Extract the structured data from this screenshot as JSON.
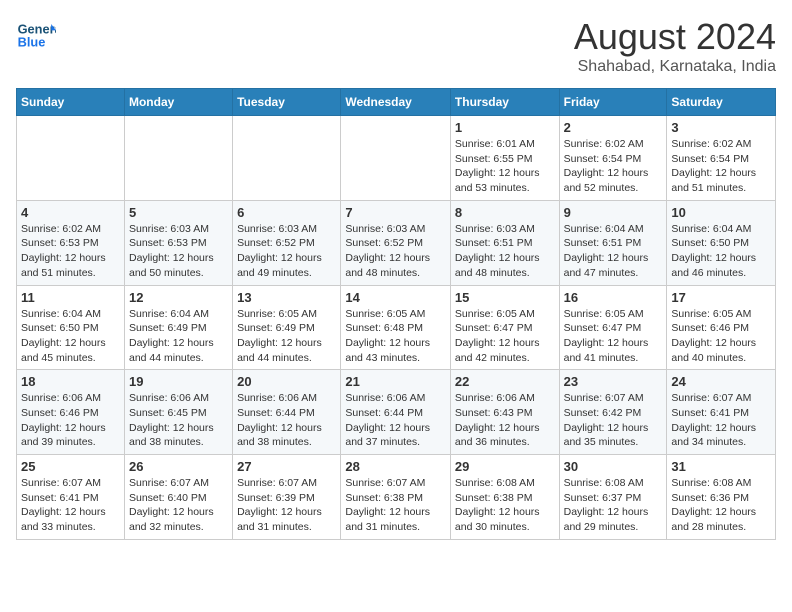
{
  "header": {
    "logo_line1": "General",
    "logo_line2": "Blue",
    "month": "August 2024",
    "location": "Shahabad, Karnataka, India"
  },
  "weekdays": [
    "Sunday",
    "Monday",
    "Tuesday",
    "Wednesday",
    "Thursday",
    "Friday",
    "Saturday"
  ],
  "weeks": [
    [
      {
        "day": "",
        "info": ""
      },
      {
        "day": "",
        "info": ""
      },
      {
        "day": "",
        "info": ""
      },
      {
        "day": "",
        "info": ""
      },
      {
        "day": "1",
        "info": "Sunrise: 6:01 AM\nSunset: 6:55 PM\nDaylight: 12 hours\nand 53 minutes."
      },
      {
        "day": "2",
        "info": "Sunrise: 6:02 AM\nSunset: 6:54 PM\nDaylight: 12 hours\nand 52 minutes."
      },
      {
        "day": "3",
        "info": "Sunrise: 6:02 AM\nSunset: 6:54 PM\nDaylight: 12 hours\nand 51 minutes."
      }
    ],
    [
      {
        "day": "4",
        "info": "Sunrise: 6:02 AM\nSunset: 6:53 PM\nDaylight: 12 hours\nand 51 minutes."
      },
      {
        "day": "5",
        "info": "Sunrise: 6:03 AM\nSunset: 6:53 PM\nDaylight: 12 hours\nand 50 minutes."
      },
      {
        "day": "6",
        "info": "Sunrise: 6:03 AM\nSunset: 6:52 PM\nDaylight: 12 hours\nand 49 minutes."
      },
      {
        "day": "7",
        "info": "Sunrise: 6:03 AM\nSunset: 6:52 PM\nDaylight: 12 hours\nand 48 minutes."
      },
      {
        "day": "8",
        "info": "Sunrise: 6:03 AM\nSunset: 6:51 PM\nDaylight: 12 hours\nand 48 minutes."
      },
      {
        "day": "9",
        "info": "Sunrise: 6:04 AM\nSunset: 6:51 PM\nDaylight: 12 hours\nand 47 minutes."
      },
      {
        "day": "10",
        "info": "Sunrise: 6:04 AM\nSunset: 6:50 PM\nDaylight: 12 hours\nand 46 minutes."
      }
    ],
    [
      {
        "day": "11",
        "info": "Sunrise: 6:04 AM\nSunset: 6:50 PM\nDaylight: 12 hours\nand 45 minutes."
      },
      {
        "day": "12",
        "info": "Sunrise: 6:04 AM\nSunset: 6:49 PM\nDaylight: 12 hours\nand 44 minutes."
      },
      {
        "day": "13",
        "info": "Sunrise: 6:05 AM\nSunset: 6:49 PM\nDaylight: 12 hours\nand 44 minutes."
      },
      {
        "day": "14",
        "info": "Sunrise: 6:05 AM\nSunset: 6:48 PM\nDaylight: 12 hours\nand 43 minutes."
      },
      {
        "day": "15",
        "info": "Sunrise: 6:05 AM\nSunset: 6:47 PM\nDaylight: 12 hours\nand 42 minutes."
      },
      {
        "day": "16",
        "info": "Sunrise: 6:05 AM\nSunset: 6:47 PM\nDaylight: 12 hours\nand 41 minutes."
      },
      {
        "day": "17",
        "info": "Sunrise: 6:05 AM\nSunset: 6:46 PM\nDaylight: 12 hours\nand 40 minutes."
      }
    ],
    [
      {
        "day": "18",
        "info": "Sunrise: 6:06 AM\nSunset: 6:46 PM\nDaylight: 12 hours\nand 39 minutes."
      },
      {
        "day": "19",
        "info": "Sunrise: 6:06 AM\nSunset: 6:45 PM\nDaylight: 12 hours\nand 38 minutes."
      },
      {
        "day": "20",
        "info": "Sunrise: 6:06 AM\nSunset: 6:44 PM\nDaylight: 12 hours\nand 38 minutes."
      },
      {
        "day": "21",
        "info": "Sunrise: 6:06 AM\nSunset: 6:44 PM\nDaylight: 12 hours\nand 37 minutes."
      },
      {
        "day": "22",
        "info": "Sunrise: 6:06 AM\nSunset: 6:43 PM\nDaylight: 12 hours\nand 36 minutes."
      },
      {
        "day": "23",
        "info": "Sunrise: 6:07 AM\nSunset: 6:42 PM\nDaylight: 12 hours\nand 35 minutes."
      },
      {
        "day": "24",
        "info": "Sunrise: 6:07 AM\nSunset: 6:41 PM\nDaylight: 12 hours\nand 34 minutes."
      }
    ],
    [
      {
        "day": "25",
        "info": "Sunrise: 6:07 AM\nSunset: 6:41 PM\nDaylight: 12 hours\nand 33 minutes."
      },
      {
        "day": "26",
        "info": "Sunrise: 6:07 AM\nSunset: 6:40 PM\nDaylight: 12 hours\nand 32 minutes."
      },
      {
        "day": "27",
        "info": "Sunrise: 6:07 AM\nSunset: 6:39 PM\nDaylight: 12 hours\nand 31 minutes."
      },
      {
        "day": "28",
        "info": "Sunrise: 6:07 AM\nSunset: 6:38 PM\nDaylight: 12 hours\nand 31 minutes."
      },
      {
        "day": "29",
        "info": "Sunrise: 6:08 AM\nSunset: 6:38 PM\nDaylight: 12 hours\nand 30 minutes."
      },
      {
        "day": "30",
        "info": "Sunrise: 6:08 AM\nSunset: 6:37 PM\nDaylight: 12 hours\nand 29 minutes."
      },
      {
        "day": "31",
        "info": "Sunrise: 6:08 AM\nSunset: 6:36 PM\nDaylight: 12 hours\nand 28 minutes."
      }
    ]
  ]
}
